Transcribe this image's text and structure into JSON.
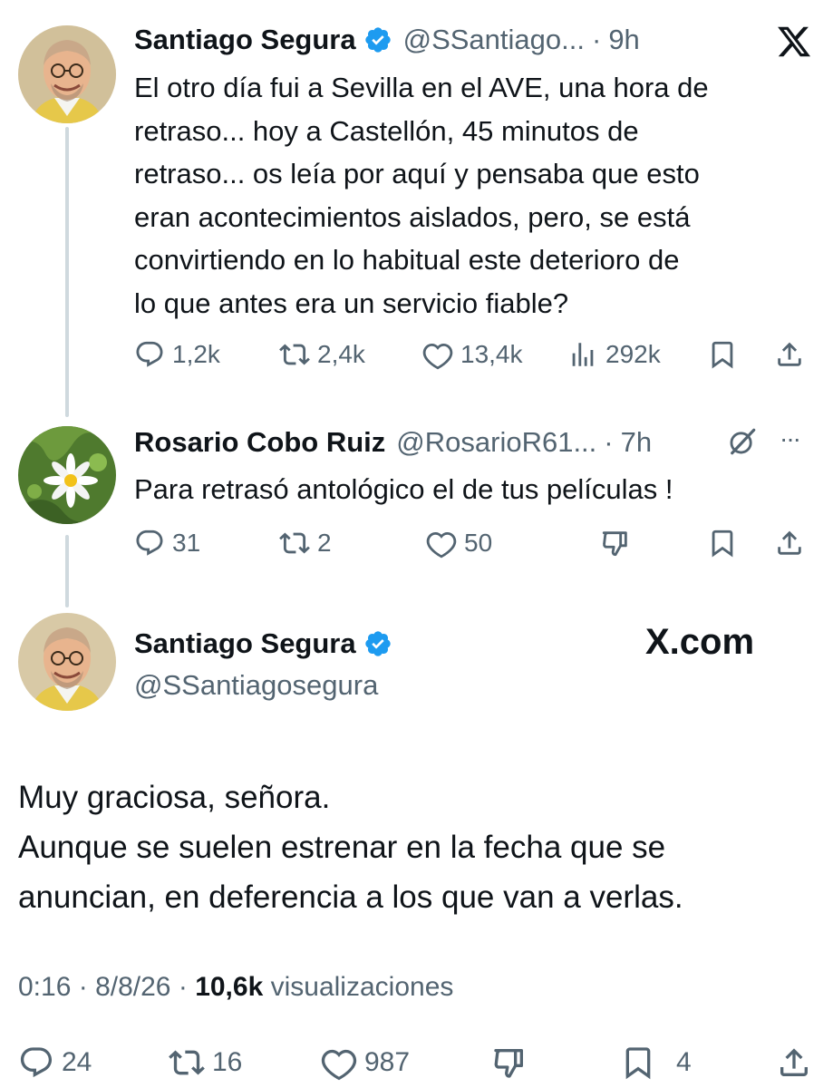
{
  "tweet1": {
    "name": "Santiago Segura",
    "handle": "@SSantiago...",
    "dot": "·",
    "time": "9h",
    "lines": [
      "El otro día fui a Sevilla en el AVE, una hora de",
      "retraso... hoy a Castellón, 45 minutos de",
      "retraso... os leía por aquí y pensaba que esto",
      "eran acontecimientos aislados, pero, se está",
      "convirtiendo en lo habitual este deterioro de",
      "lo que antes era un servicio fiable?"
    ],
    "replies": "1,2k",
    "reposts": "2,4k",
    "likes": "13,4k",
    "views": "292k"
  },
  "tweet2": {
    "name": "Rosario Cobo Ruiz",
    "handle": "@RosarioR61...",
    "dot": "·",
    "time": "7h",
    "more": "···",
    "text": "Para retrasó antológico el de tus películas !",
    "replies": "31",
    "reposts": "2",
    "likes": "50"
  },
  "tweet3": {
    "name": "Santiago Segura",
    "handle": "@SSantiagosegura",
    "watermark": "X.com",
    "lines": [
      "Muy graciosa, señora.",
      "Aunque se suelen estrenar en la fecha que se",
      "anuncian, en deferencia a los que van a verlas."
    ],
    "meta_time": "0:16",
    "meta_date": "8/8/26",
    "meta_dot": "·",
    "meta_views": "10,6k",
    "meta_views_label": "visualizaciones",
    "replies": "24",
    "reposts": "16",
    "likes": "987",
    "bookmarks": "4"
  },
  "colors": {
    "text": "#0f1419",
    "secondary": "#536471",
    "verified": "#1d9bf0",
    "thread_line": "#cfd9de"
  },
  "icons": [
    "x-logo-icon",
    "verified-badge-icon",
    "reply-icon",
    "repost-icon",
    "like-icon",
    "views-icon",
    "bookmark-icon",
    "share-icon",
    "grok-icon",
    "more-icon",
    "dislike-icon"
  ]
}
